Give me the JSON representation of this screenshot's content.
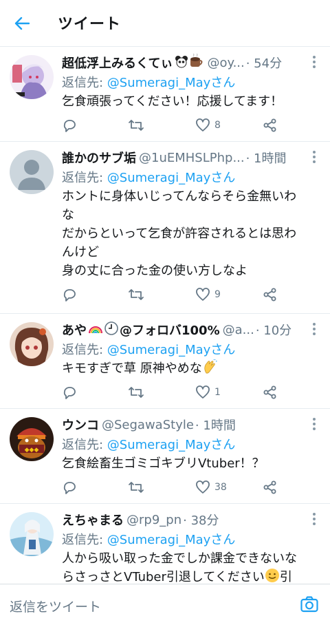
{
  "header": {
    "title": "ツイート",
    "back_icon": "arrow-left-icon"
  },
  "accent": "#1da1f2",
  "tweets": [
    {
      "name": "超低浮上みるくてぃ",
      "name_emoji": "🐼☕",
      "handle": "@oy...",
      "time": "· 54分",
      "reply_prefix": "返信先: ",
      "reply_to": "@Sumeragi_Mayさん",
      "lines": [
        "乞食頑張ってください！応援してます！"
      ],
      "likes": "8"
    },
    {
      "name": "誰かのサブ垢",
      "handle": "@1uEMHSLPhp...",
      "time": "· 1時間",
      "reply_prefix": "返信先: ",
      "reply_to": "@Sumeragi_Mayさん",
      "lines": [
        "ホントに身体いじってんならそら金無いわ",
        "な",
        "だからといって乞食が許容されるとは思わ",
        "んけど",
        "身の丈に合った金の使い方しなよ"
      ],
      "likes": "9"
    },
    {
      "name": "あや",
      "name_emoji": "🌈🕒",
      "name_suffix": "@フォロバ100%",
      "handle": "@a...",
      "time": "· 10分",
      "reply_prefix": "返信先: ",
      "reply_to": "@Sumeragi_Mayさん",
      "lines": [
        "キモすぎで草 原神やめな"
      ],
      "line_emoji": "👏",
      "likes": "1"
    },
    {
      "name": "ウンコ",
      "handle": "@SegawaStyle",
      "time": "· 1時間",
      "reply_prefix": "返信先: ",
      "reply_to": "@Sumeragi_Mayさん",
      "lines": [
        "乞食絵畜生ゴミゴキブリVtuber！？"
      ],
      "likes": "38"
    },
    {
      "name": "えちゃまる",
      "handle": "@rp9_pn",
      "time": "· 38分",
      "reply_prefix": "返信先: ",
      "reply_to": "@Sumeragi_Mayさん",
      "lines": [
        "人から吸い取った金でしか課金できないな",
        "らさっさとVTuber引退してください"
      ],
      "line_emoji": "🙂",
      "line_tail": "引",
      "likes": ""
    }
  ],
  "composer": {
    "placeholder": "返信をツイート",
    "camera_icon": "camera-icon"
  }
}
